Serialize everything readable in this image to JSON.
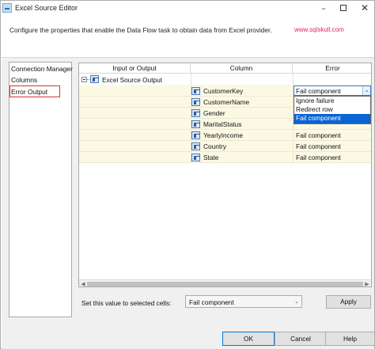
{
  "window": {
    "title": "Excel Source Editor"
  },
  "header": {
    "description": "Configure the properties that enable the Data Flow task to obtain data from Excel provider.",
    "watermark": "www.sqlskull.com"
  },
  "nav": {
    "items": [
      {
        "label": "Connection Manager"
      },
      {
        "label": "Columns"
      },
      {
        "label": "Error Output",
        "selected": true
      }
    ]
  },
  "grid": {
    "columns": [
      "Input or Output",
      "Column",
      "Error"
    ],
    "output_name": "Excel Source Output",
    "rows": [
      {
        "column": "CustomerKey",
        "error": "Fail component"
      },
      {
        "column": "CustomerName",
        "error": ""
      },
      {
        "column": "Gender",
        "error": ""
      },
      {
        "column": "MaritalStatus",
        "error": ""
      },
      {
        "column": "YearlyIncome",
        "error": "Fail component"
      },
      {
        "column": "Country",
        "error": "Fail component"
      },
      {
        "column": "State",
        "error": "Fail component"
      }
    ],
    "dropdown_options": [
      "Ignore failure",
      "Redirect row",
      "Fail component"
    ],
    "dropdown_selected": "Fail component"
  },
  "bottom": {
    "set_label": "Set this value to selected cells:",
    "set_value": "Fail component",
    "apply_label": "Apply"
  },
  "footer": {
    "ok_label": "OK",
    "cancel_label": "Cancel",
    "help_label": "Help"
  },
  "colors": {
    "selection": "#0a64d3",
    "highlight_box": "#d8312f",
    "row_background": "#fbf9e3",
    "watermark": "#e6245a"
  }
}
